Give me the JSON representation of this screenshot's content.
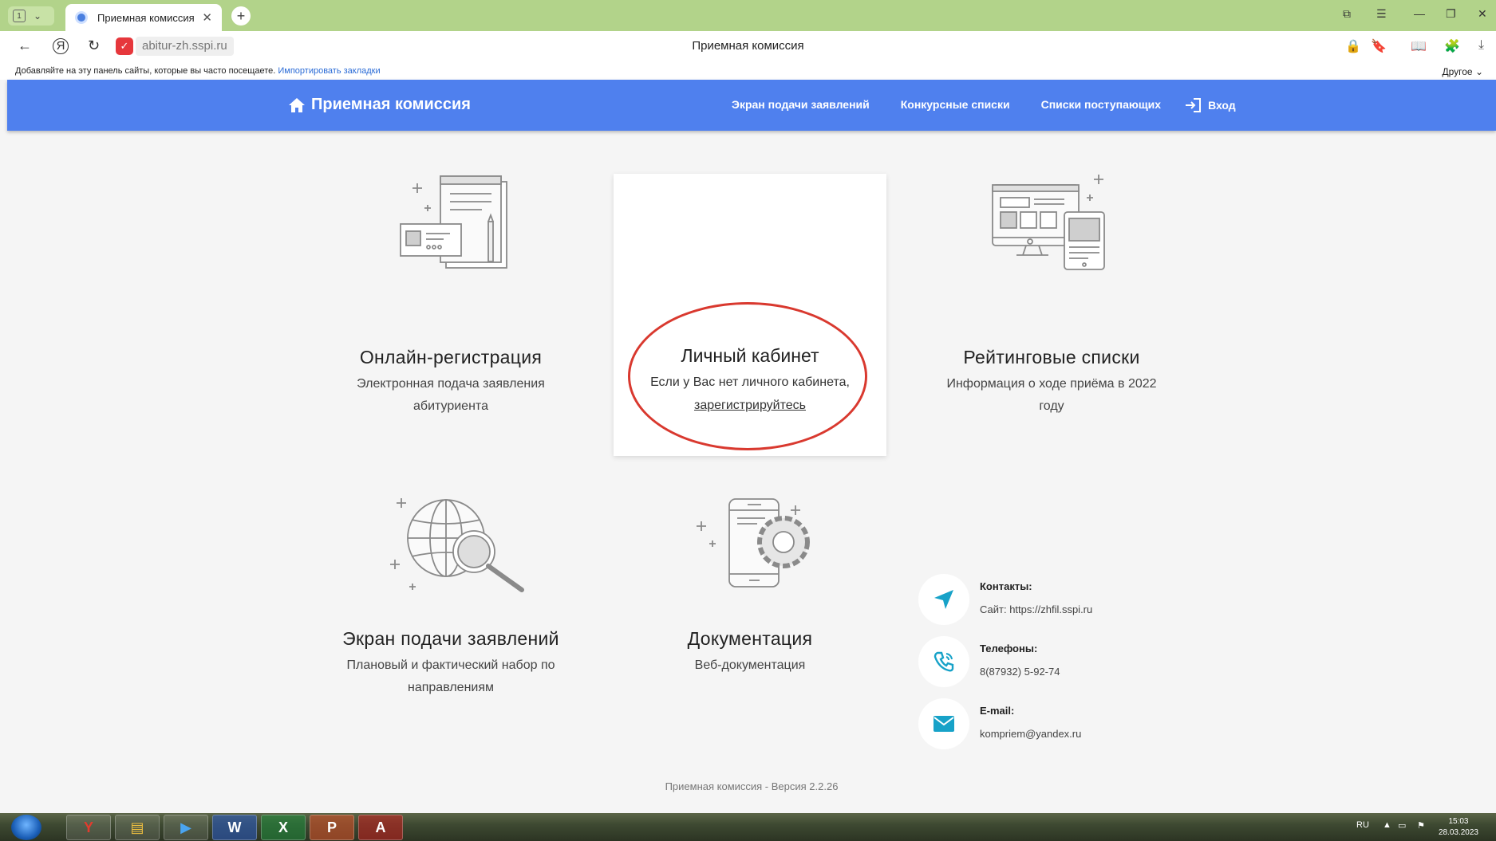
{
  "browser": {
    "tab_count": "1",
    "tab_title": "Приемная комиссия",
    "url": "abitur-zh.sspi.ru",
    "page_title": "Приемная комиссия",
    "bookmarks_hint": "Добавляйте на эту панель сайты, которые вы часто посещаете.",
    "bookmarks_import": "Импортировать закладки",
    "bookmarks_other": "Другое"
  },
  "site": {
    "brand": "Приемная комиссия",
    "nav": [
      {
        "label": "Экран подачи заявлений"
      },
      {
        "label": "Конкурсные списки"
      },
      {
        "label": "Списки поступающих"
      },
      {
        "label": "Вход"
      }
    ],
    "blocks": {
      "registration": {
        "title": "Онлайн-регистрация",
        "line1": "Электронная подача заявления",
        "line2": "абитуриента"
      },
      "cabinet": {
        "title": "Личный кабинет",
        "text": "Если у Вас нет личного кабинета,",
        "link": "зарегистрируйтесь"
      },
      "rating": {
        "title": "Рейтинговые списки",
        "line1": "Информация о ходе приёма в 2022",
        "line2": "году"
      },
      "screen": {
        "title": "Экран подачи заявлений",
        "line1": "Плановый и фактический набор по",
        "line2": "направлениям"
      },
      "docs": {
        "title": "Документация",
        "line1": "Веб-документация"
      }
    },
    "contacts": [
      {
        "title": "Контакты:",
        "value": "Сайт: https://zhfil.sspi.ru"
      },
      {
        "title": "Телефоны:",
        "value": "8(87932) 5-92-74"
      },
      {
        "title": "E-mail:",
        "value": "kompriem@yandex.ru"
      }
    ],
    "footer": "Приемная комиссия - Версия 2.2.26",
    "colors": {
      "nav": "#4f80ee",
      "accent": "#17a2c8",
      "highlight": "#d9392f"
    }
  },
  "taskbar": {
    "lang": "RU",
    "time": "15:03",
    "date": "28.03.2023",
    "apps": [
      "yandex-browser",
      "file-manager",
      "media-player",
      "word",
      "excel",
      "presentation",
      "pdf-reader"
    ]
  }
}
